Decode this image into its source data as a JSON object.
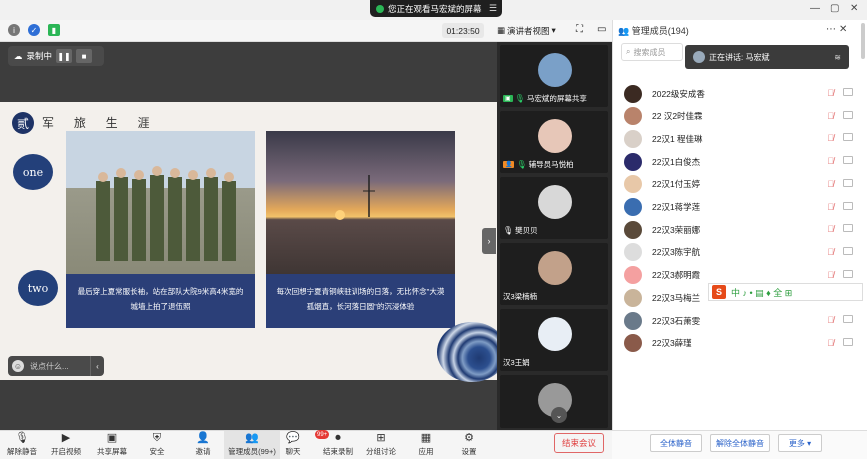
{
  "notice": "您正在观看马宏斌的屏幕",
  "timer": "01:23:50",
  "presenter_view": "演讲者视图",
  "recording": "录制中",
  "slide": {
    "mark": "贰",
    "title": "军 旅 生 涯",
    "bubble_one": "one",
    "bubble_two": "two",
    "caption1": "最后穿上夏常服长袖，站在部队大院9米高4米宽的城墙上拍了退伍照",
    "caption2": "每次回想宁夏青铜峡驻训场的日落，无比怀念\"大漠孤烟直，长河落日圆\"的沉浸体验"
  },
  "comment_placeholder": "说点什么...",
  "tiles": [
    {
      "name": "马宏斌的屏幕共享",
      "face": "#7aa0c8"
    },
    {
      "name": "辅导员马悦柏",
      "face": "#e7c7b8"
    },
    {
      "name": "樊贝贝",
      "face": "#d8d8d8"
    },
    {
      "name": "汉3梁楠楠",
      "face": "#c2a18a"
    },
    {
      "name": "汉3王娟",
      "face": "#e8eef5"
    },
    {
      "name": "",
      "face": "#999"
    }
  ],
  "panel": {
    "title": "管理成员(194)",
    "search_placeholder": "搜索成员",
    "speaking": "正在讲话: 马宏斌",
    "members": [
      {
        "name": "2022级安成香",
        "c": "#3b2a22"
      },
      {
        "name": "22 汉2时佳霖",
        "c": "#b9836b"
      },
      {
        "name": "22汉1 程佳琳",
        "c": "#d9d0c8"
      },
      {
        "name": "22汉1白俊杰",
        "c": "#2b2b6b"
      },
      {
        "name": "22汉1付玉婷",
        "c": "#e8c8a8"
      },
      {
        "name": "22汉1蒋学莲",
        "c": "#3a6db0"
      },
      {
        "name": "22汉3荣丽娜",
        "c": "#5a4a3a"
      },
      {
        "name": "22汉3陈宇航",
        "c": "#ddd"
      },
      {
        "name": "22汉3郝明霞",
        "c": "#f4a0a0"
      },
      {
        "name": "22汉3马梅兰",
        "c": "#c9b49a"
      },
      {
        "name": "22汉3石萧雯",
        "c": "#6a7a8a"
      },
      {
        "name": "22汉3薛瑾",
        "c": "#8a5a4a"
      }
    ],
    "mute_all": "全体静音",
    "unmute_all": "解除全体静音",
    "more": "更多"
  },
  "ime": {
    "logo": "S",
    "chars": "中 ♪ • ▤ ♦ 全 ⊞"
  },
  "bottom": [
    {
      "label": "解除静音",
      "icon": "🎙"
    },
    {
      "label": "开启视频",
      "icon": "▶"
    },
    {
      "label": "共享屏幕",
      "icon": "▣"
    },
    {
      "label": "安全",
      "icon": "⛨"
    },
    {
      "label": "邀请",
      "icon": "👤"
    },
    {
      "label": "管理成员(99+)",
      "icon": "👥"
    },
    {
      "label": "聊天",
      "icon": "💬"
    },
    {
      "label": "结束录制",
      "icon": "⏺"
    },
    {
      "label": "分组讨论",
      "icon": "⊞"
    },
    {
      "label": "应用",
      "icon": "▦"
    },
    {
      "label": "设置",
      "icon": "⚙"
    }
  ],
  "chat_badge": "99+",
  "end_meeting": "结束会议"
}
